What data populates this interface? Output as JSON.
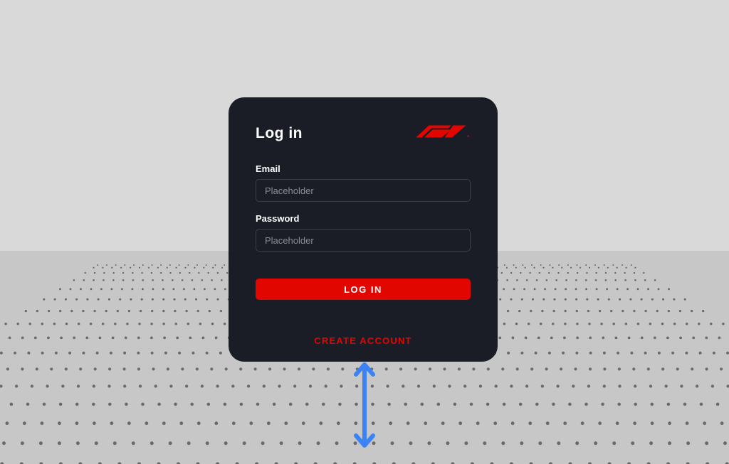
{
  "card": {
    "title": "Log in",
    "email": {
      "label": "Email",
      "placeholder": "Placeholder",
      "value": ""
    },
    "password": {
      "label": "Password",
      "placeholder": "Placeholder",
      "value": ""
    },
    "submit_label": "LOG IN",
    "create_account_label": "CREATE ACCOUNT"
  },
  "colors": {
    "accent": "#e10600",
    "card_bg": "#1b1d26",
    "page_bg": "#d9d9d9",
    "arrow": "#3b82f6"
  }
}
